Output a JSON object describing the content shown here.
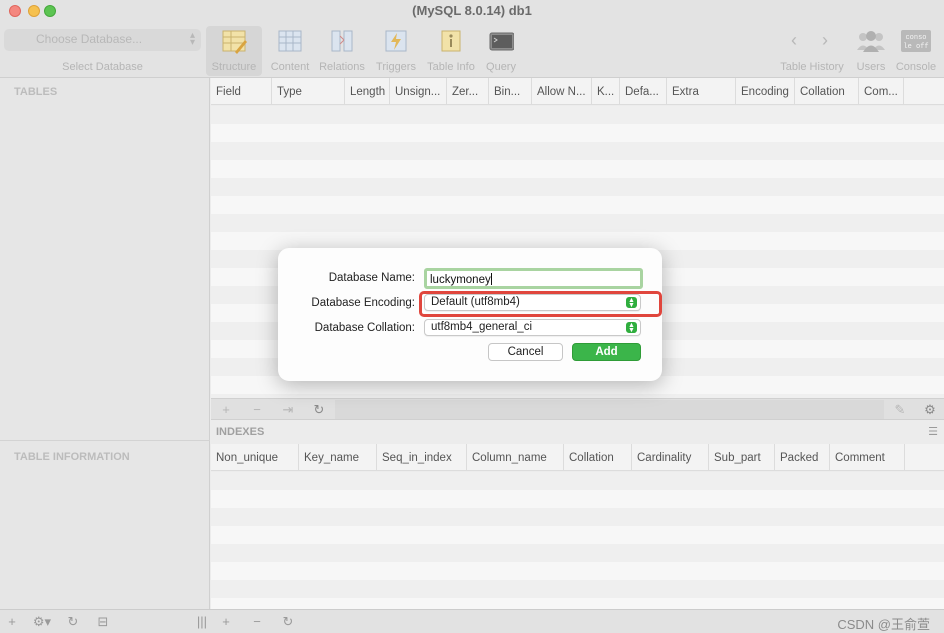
{
  "window": {
    "title": "(MySQL 8.0.14) db1"
  },
  "toolbar": {
    "db_select_placeholder": "Choose Database...",
    "db_select_caption": "Select Database",
    "tools": [
      {
        "label": "Structure",
        "icon": "structure-icon",
        "active": true
      },
      {
        "label": "Content",
        "icon": "content-icon"
      },
      {
        "label": "Relations",
        "icon": "relations-icon"
      },
      {
        "label": "Triggers",
        "icon": "triggers-icon"
      },
      {
        "label": "Table Info",
        "icon": "table-info-icon"
      },
      {
        "label": "Query",
        "icon": "query-icon"
      }
    ],
    "table_history_label": "Table History",
    "users_label": "Users",
    "console_label": "Console",
    "console_icon_text": "conso le off"
  },
  "sidebar": {
    "tables_header": "TABLES",
    "table_info_header": "TABLE INFORMATION"
  },
  "structure": {
    "columns": [
      "Field",
      "Type",
      "Length",
      "Unsign...",
      "Zer...",
      "Bin...",
      "Allow N...",
      "K...",
      "Defa...",
      "Extra",
      "Encoding",
      "Collation",
      "Com..."
    ]
  },
  "indexes": {
    "title": "INDEXES",
    "columns": [
      "Non_unique",
      "Key_name",
      "Seq_in_index",
      "Column_name",
      "Collation",
      "Cardinality",
      "Sub_part",
      "Packed",
      "Comment"
    ]
  },
  "dialog": {
    "name_label": "Database Name:",
    "name_value": "luckymoney",
    "encoding_label": "Database Encoding:",
    "encoding_value": "Default (utf8mb4)",
    "collation_label": "Database Collation:",
    "collation_value": "utf8mb4_general_ci",
    "cancel_label": "Cancel",
    "add_label": "Add"
  },
  "colors": {
    "accent_green": "#3bb54a",
    "highlight_red": "#e0463d",
    "focus_ring": "#a9d4a1"
  },
  "watermark": "CSDN @王俞萱"
}
